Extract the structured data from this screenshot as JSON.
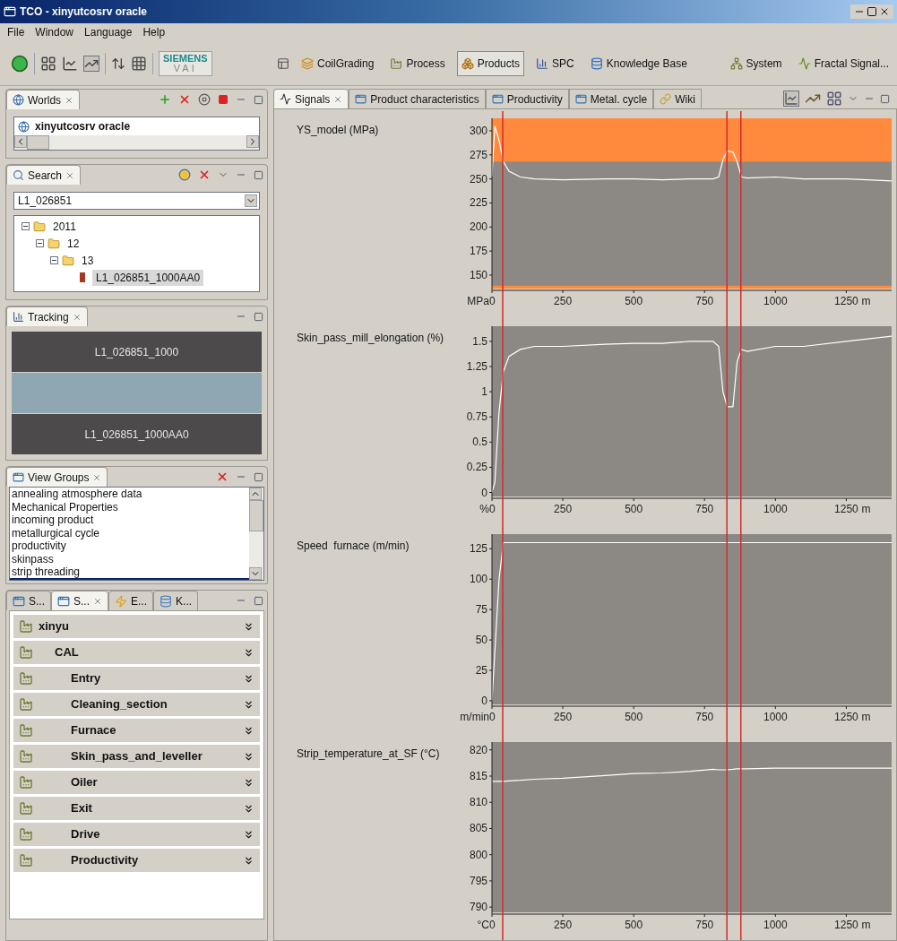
{
  "window": {
    "title": "TCO - xinyutcosrv oracle"
  },
  "menu": [
    "File",
    "Window",
    "Language",
    "Help"
  ],
  "toolbar": {
    "logo": {
      "line_1": "SIEMENS",
      "line_2": "VAI"
    },
    "perspectives": [
      {
        "label": "CoilGrading",
        "kind": "coil",
        "selected": false
      },
      {
        "label": "Process",
        "kind": "factory",
        "selected": false
      },
      {
        "label": "Products",
        "kind": "products",
        "selected": true
      },
      {
        "label": "SPC",
        "kind": "bars",
        "selected": false
      },
      {
        "label": "Knowledge Base",
        "kind": "database",
        "selected": false
      },
      {
        "label": "System",
        "kind": "network",
        "selected": false
      },
      {
        "label": "Fractal Signal...",
        "kind": "signal",
        "selected": false
      }
    ]
  },
  "worlds_panel": {
    "tab": "Worlds",
    "items": [
      "xinyutcosrv oracle"
    ]
  },
  "search_panel": {
    "tab": "Search",
    "value": "L1_026851",
    "tree": [
      {
        "label": "2011",
        "expanded": true,
        "selected": false,
        "children": [
          {
            "label": "12",
            "expanded": true,
            "selected": false,
            "children": [
              {
                "label": "13",
                "expanded": true,
                "selected": false,
                "children": [
                  {
                    "label": "L1_026851_1000AA0",
                    "selected": true
                  }
                ]
              }
            ]
          }
        ]
      }
    ]
  },
  "tracking_panel": {
    "tab": "Tracking",
    "segments": [
      {
        "label": "L1_026851_1000",
        "color": "#4c4a4a"
      },
      {
        "color": "#8ea7b3"
      },
      {
        "label": "L1_026851_1000AA0",
        "color": "#4c4a4a"
      }
    ]
  },
  "view_groups_panel": {
    "tab": "View Groups",
    "items": [
      "annealing atmosphere data",
      "Mechanical Properties",
      "incoming product",
      "metallurgical cycle",
      "productivity",
      "skinpass",
      "strip threading"
    ]
  },
  "bottom_panel": {
    "tabs": [
      {
        "label": "S...",
        "kind": "window",
        "selected": false
      },
      {
        "label": "S...",
        "kind": "window",
        "selected": true
      },
      {
        "label": "E...",
        "kind": "lightning",
        "selected": false
      },
      {
        "label": "K...",
        "kind": "database",
        "selected": false
      }
    ],
    "tree": [
      {
        "label": "xinyu",
        "children": [
          {
            "label": "CAL",
            "children": [
              {
                "label": "Entry"
              },
              {
                "label": "Cleaning_section"
              },
              {
                "label": "Furnace"
              },
              {
                "label": "Skin_pass_and_leveller"
              },
              {
                "label": "Oiler"
              },
              {
                "label": "Exit"
              },
              {
                "label": "Drive"
              },
              {
                "label": "Productivity"
              }
            ]
          }
        ]
      }
    ]
  },
  "signals_panel": {
    "tabs": [
      {
        "label": "Signals",
        "kind": "signal",
        "selected": true
      },
      {
        "label": "Product characteristics",
        "kind": "window",
        "selected": false
      },
      {
        "label": "Productivity",
        "kind": "window",
        "selected": false
      },
      {
        "label": "Metal. cycle",
        "kind": "window",
        "selected": false
      },
      {
        "label": "Wiki",
        "kind": "wiki",
        "selected": false
      }
    ],
    "charts": [
      {
        "chart_data": {
          "type": "line",
          "title": "YS_model (MPa)",
          "ylabel": "MPa",
          "x": [
            0,
            10,
            25,
            40,
            60,
            100,
            150,
            250,
            400,
            500,
            600,
            700,
            780,
            800,
            815,
            830,
            850,
            865,
            880,
            900,
            1000,
            1100,
            1250,
            1410
          ],
          "series": [
            {
              "color": "#ffffff",
              "values": [
                253,
                305,
                290,
                268,
                258,
                252,
                250,
                249,
                250,
                250,
                249,
                250,
                250,
                252,
                270,
                279,
                278,
                268,
                252,
                251,
                252,
                250,
                250,
                248
              ]
            }
          ],
          "xlim": [
            0,
            1410
          ],
          "ylim": [
            136,
            313
          ],
          "xlabel": "m",
          "xticks": [
            0,
            250,
            500,
            750,
            1000,
            1250
          ],
          "yticks": [
            150,
            175,
            200,
            225,
            250,
            275,
            300
          ],
          "bands": [
            {
              "axis": "y",
              "from": 268,
              "to": 313
            },
            {
              "axis": "y",
              "from": 136,
              "to": 139
            }
          ],
          "ref_lines": [
            {
              "axis": "x",
              "value": 38
            },
            {
              "axis": "x",
              "value": 829
            },
            {
              "axis": "x",
              "value": 878
            }
          ]
        }
      },
      {
        "chart_data": {
          "type": "line",
          "title": "Skin_pass_mill_elongation (%)",
          "ylabel": "%",
          "x": [
            0,
            10,
            25,
            40,
            60,
            100,
            150,
            250,
            400,
            500,
            600,
            700,
            780,
            800,
            815,
            830,
            850,
            865,
            880,
            900,
            1000,
            1100,
            1250,
            1410
          ],
          "series": [
            {
              "color": "#ffffff",
              "values": [
                0,
                0.1,
                0.8,
                1.2,
                1.35,
                1.42,
                1.45,
                1.45,
                1.47,
                1.48,
                1.48,
                1.5,
                1.5,
                1.45,
                1.0,
                0.85,
                0.85,
                1.3,
                1.42,
                1.4,
                1.45,
                1.45,
                1.5,
                1.55
              ]
            }
          ],
          "xlim": [
            0,
            1410
          ],
          "ylim": [
            -0.04,
            1.65
          ],
          "xlabel": "m",
          "xticks": [
            0,
            250,
            500,
            750,
            1000,
            1250
          ],
          "yticks": [
            0,
            0.25,
            0.5,
            0.75,
            1,
            1.25,
            1.5
          ],
          "ref_lines": [
            {
              "axis": "x",
              "value": 38
            },
            {
              "axis": "x",
              "value": 829
            },
            {
              "axis": "x",
              "value": 878
            }
          ]
        }
      },
      {
        "chart_data": {
          "type": "line",
          "title": "Speed  furnace (m/min)",
          "ylabel": "m/min",
          "x": [
            0,
            10,
            25,
            40,
            60,
            100,
            150,
            250,
            400,
            500,
            600,
            700,
            780,
            800,
            815,
            830,
            850,
            865,
            880,
            900,
            1000,
            1100,
            1250,
            1410
          ],
          "series": [
            {
              "color": "#ffffff",
              "values": [
                0,
                40,
                100,
                130,
                130,
                130,
                130,
                130,
                130,
                130,
                130,
                130,
                130,
                130,
                130,
                130,
                130,
                130,
                130,
                130,
                130,
                130,
                130,
                130
              ]
            }
          ],
          "xlim": [
            0,
            1410
          ],
          "ylim": [
            -3,
            137
          ],
          "xlabel": "m",
          "xticks": [
            0,
            250,
            500,
            750,
            1000,
            1250
          ],
          "yticks": [
            0,
            25,
            50,
            75,
            100,
            125
          ],
          "ref_lines": [
            {
              "axis": "x",
              "value": 38
            },
            {
              "axis": "x",
              "value": 829
            },
            {
              "axis": "x",
              "value": 878
            }
          ]
        }
      },
      {
        "chart_data": {
          "type": "line",
          "title": "Strip_temperature_at_SF (°C)",
          "ylabel": "°C",
          "x": [
            0,
            10,
            25,
            40,
            60,
            100,
            150,
            250,
            400,
            500,
            600,
            700,
            780,
            800,
            815,
            830,
            850,
            865,
            880,
            900,
            1000,
            1100,
            1250,
            1410
          ],
          "series": [
            {
              "color": "#ffffff",
              "values": [
                814,
                814,
                814,
                814,
                814.1,
                814.2,
                814.4,
                814.6,
                815.1,
                815.5,
                815.6,
                815.9,
                816.3,
                816.2,
                816.2,
                816.2,
                816.3,
                816.4,
                816.4,
                816.4,
                816.5,
                816.5,
                816.5,
                816.5
              ]
            }
          ],
          "xlim": [
            0,
            1410
          ],
          "ylim": [
            789,
            821.5
          ],
          "xlabel": "m",
          "xticks": [
            0,
            250,
            500,
            750,
            1000,
            1250
          ],
          "yticks": [
            790,
            795,
            800,
            805,
            810,
            815,
            820
          ],
          "ref_lines": [
            {
              "axis": "x",
              "value": 38
            },
            {
              "axis": "x",
              "value": 829
            },
            {
              "axis": "x",
              "value": 878
            }
          ]
        }
      }
    ]
  }
}
